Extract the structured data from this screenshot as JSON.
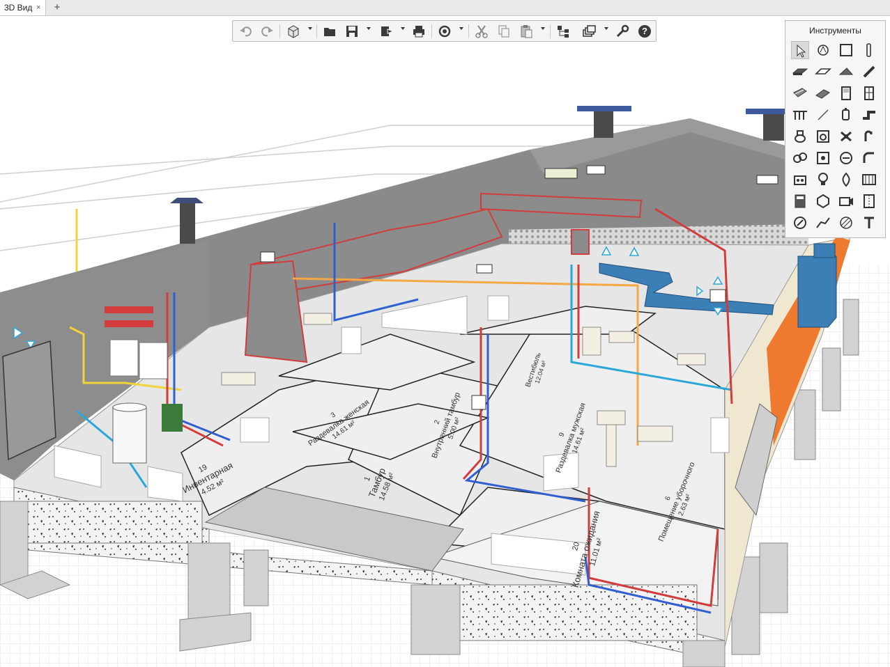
{
  "window": {
    "tab_label": "3D Вид",
    "tab_close_glyph": "×",
    "new_tab_glyph": "+"
  },
  "toolbar": {
    "buttons": [
      {
        "name": "undo-icon"
      },
      {
        "name": "redo-icon"
      },
      {
        "name": "view-cube-icon",
        "dropdown": true
      },
      {
        "name": "open-folder-icon"
      },
      {
        "name": "save-icon",
        "dropdown": true
      },
      {
        "name": "export-icon",
        "dropdown": true
      },
      {
        "name": "print-icon"
      },
      {
        "name": "orbit-icon",
        "dropdown": true
      },
      {
        "name": "cut-icon"
      },
      {
        "name": "copy-icon"
      },
      {
        "name": "paste-icon",
        "dropdown": true
      },
      {
        "name": "structure-icon"
      },
      {
        "name": "layers-icon",
        "dropdown": true
      },
      {
        "name": "wrench-icon"
      },
      {
        "name": "help-icon"
      }
    ]
  },
  "tools_panel": {
    "title": "Инструменты",
    "selected": "pointer-tool-icon",
    "tools": [
      "pointer-tool-icon",
      "dimension-tool-icon",
      "room-tool-icon",
      "column-tool-icon",
      "slab-tool-icon",
      "floor-tool-icon",
      "roof-tool-icon",
      "beam-tool-icon",
      "stair-tool-icon",
      "ramp-tool-icon",
      "door-tool-icon",
      "window-tool-icon",
      "railing-tool-icon",
      "line-tool-icon",
      "fixture-tool-icon",
      "pipe-fitting-tool-icon",
      "toilet-tool-icon",
      "washer-tool-icon",
      "valve-tool-icon",
      "duct-tool-icon",
      "fan-tool-icon",
      "boiler-tool-icon",
      "pump-tool-icon",
      "elbow-tool-icon",
      "equipment-tool-icon",
      "lamp-tool-icon",
      "fire-tool-icon",
      "radiator-tool-icon",
      "cabinet-tool-icon",
      "object-tool-icon",
      "camera-tool-icon",
      "section-tool-icon",
      "compass-tool-icon",
      "polyline-tool-icon",
      "hatch-tool-icon",
      "text-tool-icon"
    ]
  },
  "model": {
    "rooms": [
      {
        "number": "19",
        "name": "Инвентарная",
        "area": "4.52 м²"
      },
      {
        "number": "1",
        "name": "Тамбур",
        "area": "14.58 м²"
      },
      {
        "number": "20",
        "name": "Комната ожидания",
        "area": "11.01 м²"
      },
      {
        "number": "2",
        "name": "Внутренний тамбур",
        "area": "5.00 м²"
      },
      {
        "number": "3",
        "name": "Раздевалка женская",
        "area": "14.61 м²"
      },
      {
        "number": "9",
        "name": "Раздевалка мужская",
        "area": "14.61 м²"
      },
      {
        "number": "6",
        "name": "Помещение уборочного",
        "area": "2.63 м²"
      },
      {
        "number": "",
        "name": "Вестибюль",
        "area": "12.04 м²"
      }
    ]
  },
  "colors": {
    "wall_gray": "#8c8c8c",
    "duct_red": "#d23c3c",
    "duct_blue": "#3b7fb6",
    "accent_orange": "#ef7a2f",
    "gas_yellow": "#f0d43a",
    "pipe_blue": "#2f5fd0",
    "vent_blue": "#2aa7d8"
  }
}
